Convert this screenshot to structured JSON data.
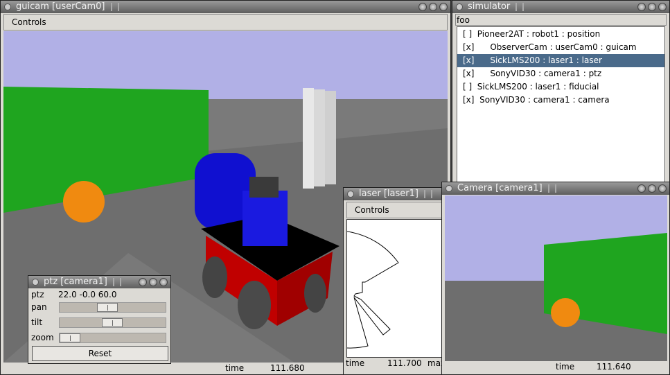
{
  "guicam": {
    "title": "guicam [userCam0]",
    "menu": "Controls",
    "time_label": "time",
    "time_value": "111.680"
  },
  "simulator": {
    "title": "simulator",
    "menu": "foo",
    "items": [
      {
        "text": "[ ]  Pioneer2AT : robot1 : position",
        "selected": false
      },
      {
        "text": "[x]      ObserverCam : userCam0 : guicam",
        "selected": false
      },
      {
        "text": "[x]      SickLMS200 : laser1 : laser",
        "selected": true
      },
      {
        "text": "[x]      SonyVID30 : camera1 : ptz",
        "selected": false
      },
      {
        "text": "[ ]  SickLMS200 : laser1 : fiducial",
        "selected": false
      },
      {
        "text": "[x]  SonyVID30 : camera1 : camera",
        "selected": false
      }
    ]
  },
  "laser": {
    "title": "laser [laser1]",
    "menu": "Controls",
    "time_label": "time",
    "time_value": "111.700",
    "max_label": "max"
  },
  "camera": {
    "title": "Camera [camera1]",
    "time_label": "time",
    "time_value": "111.640"
  },
  "ptz": {
    "title": "ptz [camera1]",
    "ptz_label": "ptz",
    "ptz_value": "22.0 -0.0 60.0",
    "pan_label": "pan",
    "pan_level": 0.45,
    "tilt_label": "tilt",
    "tilt_level": 0.5,
    "zoom_label": "zoom",
    "zoom_level": 0.0,
    "reset_label": "Reset"
  },
  "colors": {
    "sky": "#b1b0e6",
    "floor": "#6e6e6e",
    "wall": "#1fa51f",
    "ball": "#f08a10",
    "robot_body": "#c00000",
    "robot_top": "#1010d0",
    "selection": "#4a6a8a"
  }
}
